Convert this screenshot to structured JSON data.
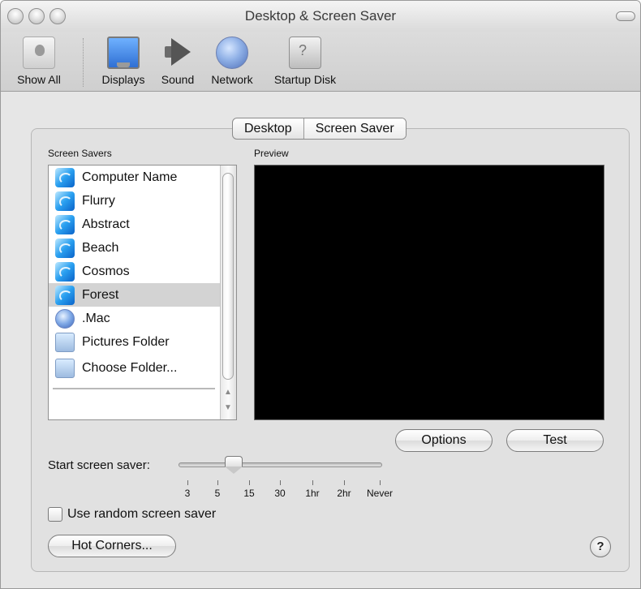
{
  "window": {
    "title": "Desktop & Screen Saver"
  },
  "toolbar": {
    "items": [
      {
        "label": "Show All",
        "icon": "apple-icon"
      },
      {
        "label": "Displays",
        "icon": "display-icon"
      },
      {
        "label": "Sound",
        "icon": "speaker-icon"
      },
      {
        "label": "Network",
        "icon": "globe-icon"
      },
      {
        "label": "Startup Disk",
        "icon": "disk-icon"
      }
    ]
  },
  "tabs": [
    {
      "label": "Desktop",
      "active": false
    },
    {
      "label": "Screen Saver",
      "active": true
    }
  ],
  "screen_savers": {
    "label": "Screen Savers",
    "items": [
      {
        "label": "Computer Name",
        "icon": "screensaver-icon",
        "selected": false
      },
      {
        "label": "Flurry",
        "icon": "screensaver-icon",
        "selected": false
      },
      {
        "label": "Abstract",
        "icon": "screensaver-icon",
        "selected": false
      },
      {
        "label": "Beach",
        "icon": "screensaver-icon",
        "selected": false
      },
      {
        "label": "Cosmos",
        "icon": "screensaver-icon",
        "selected": false
      },
      {
        "label": "Forest",
        "icon": "screensaver-icon",
        "selected": true
      },
      {
        "label": ".Mac",
        "icon": "dotmac-icon",
        "selected": false
      },
      {
        "label": "Pictures Folder",
        "icon": "folder-icon",
        "selected": false
      },
      {
        "label": "Choose Folder...",
        "icon": "folder-icon",
        "selected": false
      }
    ]
  },
  "preview": {
    "label": "Preview"
  },
  "buttons": {
    "options": "Options",
    "test": "Test",
    "hot_corners": "Hot Corners...",
    "help": "?"
  },
  "start_saver": {
    "label": "Start screen saver:",
    "ticks": [
      "3",
      "5",
      "15",
      "30",
      "1hr",
      "2hr",
      "Never"
    ],
    "selected_value": "between 5 and 15"
  },
  "random": {
    "label": "Use random screen saver",
    "checked": false
  },
  "colors": {
    "window_bg": "#e6e6e6",
    "selection": "#d3d3d3",
    "preview_bg": "#000000"
  }
}
